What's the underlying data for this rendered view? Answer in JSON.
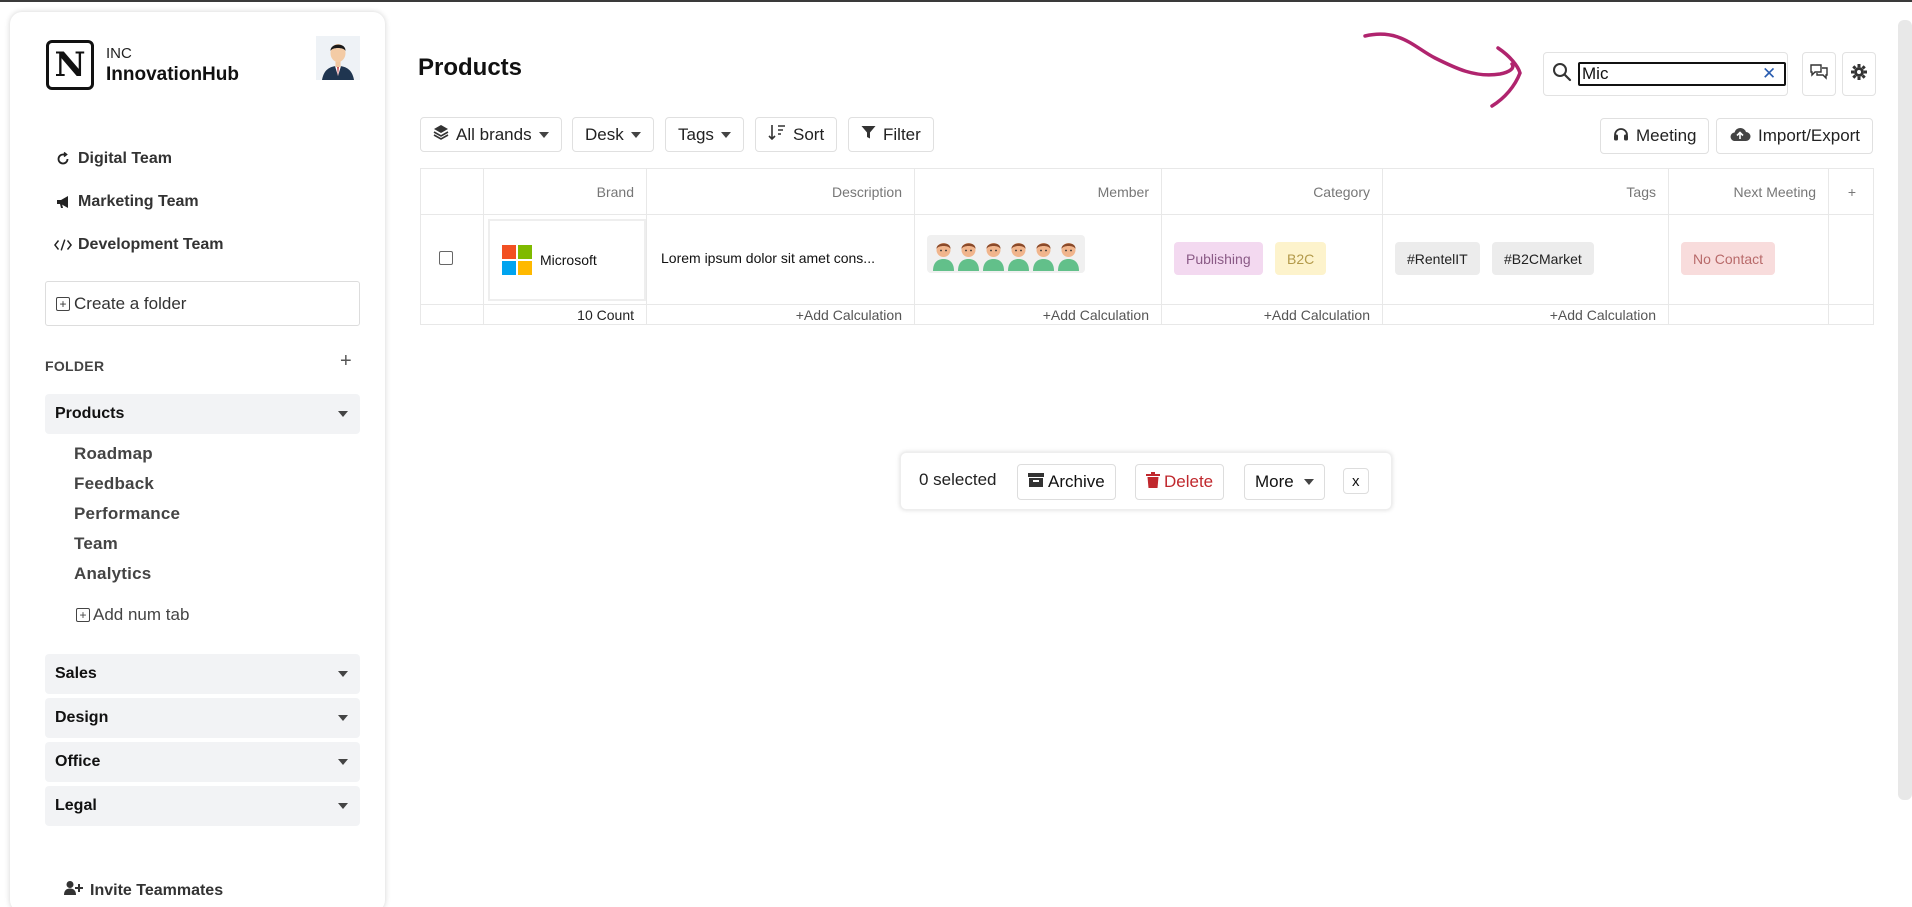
{
  "sidebar": {
    "company_type": "INC",
    "company_name": "InnovationHub",
    "teams": [
      {
        "label": "Digital Team",
        "icon": "refresh-icon"
      },
      {
        "label": "Marketing Team",
        "icon": "megaphone-icon"
      },
      {
        "label": "Development Team",
        "icon": "code-icon"
      }
    ],
    "create_folder_label": "Create a folder",
    "folder_section_label": "FOLDER",
    "folders": [
      {
        "label": "Products",
        "expanded": true,
        "items": [
          "Roadmap",
          "Feedback",
          "Performance",
          "Team",
          "Analytics"
        ],
        "add_tab_label": "Add num tab"
      },
      {
        "label": "Sales",
        "expanded": false
      },
      {
        "label": "Design",
        "expanded": false
      },
      {
        "label": "Office",
        "expanded": false
      },
      {
        "label": "Legal",
        "expanded": false
      }
    ],
    "invite_label": "Invite Teammates"
  },
  "header": {
    "title": "Products",
    "search_value": "Mic",
    "search_icon": "search-icon",
    "chat_icon": "chat-icon",
    "settings_icon": "gear-icon"
  },
  "toolbar": {
    "all_brands": "All brands",
    "desk": "Desk",
    "tags": "Tags",
    "sort": "Sort",
    "filter": "Filter",
    "meeting": "Meeting",
    "import_export": "Import/Export"
  },
  "table": {
    "columns": [
      "Brand",
      "Description",
      "Member",
      "Category",
      "Tags",
      "Next Meeting",
      "+"
    ],
    "rows": [
      {
        "brand": "Microsoft",
        "description": "Lorem ipsum dolor sit amet cons...",
        "member_count": 6,
        "categories": [
          "Publishing",
          "B2C"
        ],
        "tags": [
          "#RentelIT",
          "#B2CMarket"
        ],
        "next_meeting": "No Contact"
      }
    ],
    "footer": {
      "brand": "10 Count",
      "description": "+Add Calculation",
      "member": "+Add Calculation",
      "category": "+Add Calculation",
      "tags": "+Add Calculation"
    }
  },
  "bulk_bar": {
    "selected_text": "0 selected",
    "archive": "Archive",
    "delete": "Delete",
    "more": "More",
    "close": "x"
  },
  "colors": {
    "accent_arrow": "#b0246e",
    "publishing_bg": "#f3d9f0",
    "publishing_fg": "#8a5a86",
    "b2c_bg": "#fdf3cc",
    "b2c_fg": "#b39a4a",
    "no_contact_bg": "#f8dcdc",
    "no_contact_fg": "#b86a6a",
    "delete_fg": "#c0282d",
    "clear_x": "#2a5db0"
  }
}
